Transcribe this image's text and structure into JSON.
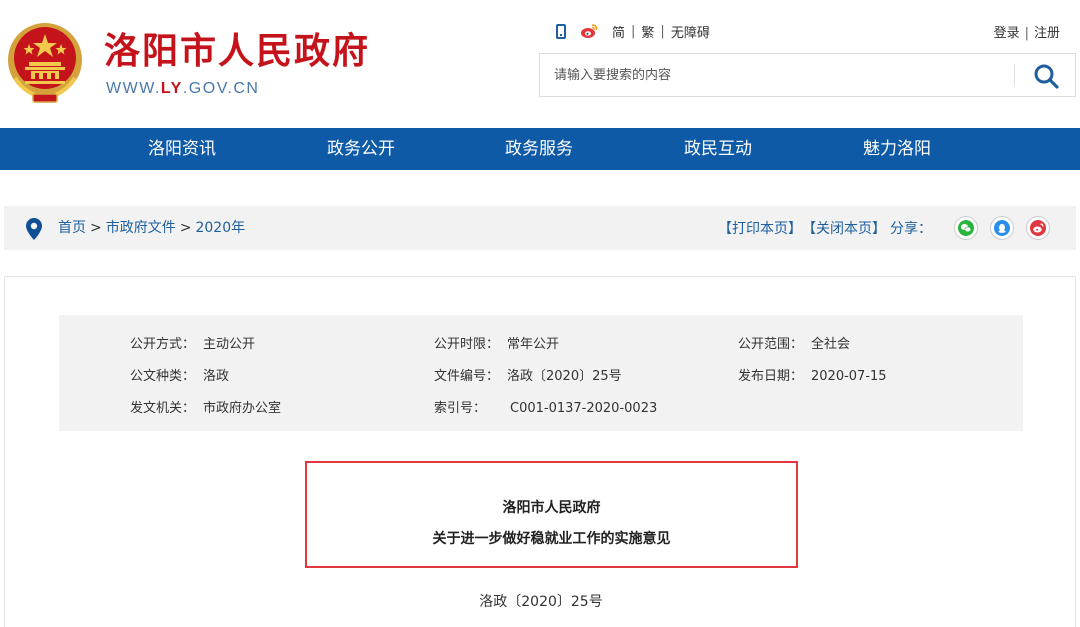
{
  "header": {
    "site_title": "洛阳市人民政府",
    "domain_prefix": "WWW.",
    "domain_highlight": "LY",
    "domain_suffix": ".GOV.CN",
    "tools": {
      "simplified": "简",
      "traditional": "繁",
      "accessibility": "无障碍"
    },
    "login": "登录",
    "register": "注册",
    "search": {
      "placeholder": "请输入要搜索的内容"
    }
  },
  "nav": {
    "items": [
      "洛阳资讯",
      "政务公开",
      "政务服务",
      "政民互动",
      "魅力洛阳"
    ]
  },
  "breadcrumb": {
    "items": [
      "首页",
      "市政府文件",
      "2020年"
    ],
    "separator": ">",
    "print": "【打印本页】",
    "close": "【关闭本页】",
    "share_label": "分享："
  },
  "meta": {
    "rows": [
      [
        {
          "key": "公开方式：",
          "value": "主动公开"
        },
        {
          "key": "公开时限：",
          "value": "常年公开"
        },
        {
          "key": "公开范围：",
          "value": "全社会"
        }
      ],
      [
        {
          "key": "公文种类：",
          "value": "洛政"
        },
        {
          "key": "文件编号：",
          "value": "洛政〔2020〕25号"
        },
        {
          "key": "发布日期：",
          "value": "2020-07-15"
        }
      ],
      [
        {
          "key": "发文机关：",
          "value": "市政府办公室"
        },
        {
          "key": "索引号：",
          "value": "C001-0137-2020-0023"
        }
      ]
    ]
  },
  "document": {
    "title_line1": "洛阳市人民政府",
    "title_line2": "关于进一步做好稳就业工作的实施意见",
    "doc_number": "洛政〔2020〕25号"
  },
  "colors": {
    "brand_red": "#c4131b",
    "nav_blue": "#0e5aa6",
    "link_blue": "#1f5fa0",
    "highlight_border": "#e0383e",
    "wechat_green": "#2ab33e",
    "qq_blue": "#2a8ee8",
    "weibo_red": "#e0383e"
  },
  "icons": [
    "national-emblem",
    "phone-icon",
    "weibo-icon",
    "search-icon",
    "location-pin-icon",
    "wechat-icon",
    "qq-icon",
    "weibo-share-icon"
  ]
}
